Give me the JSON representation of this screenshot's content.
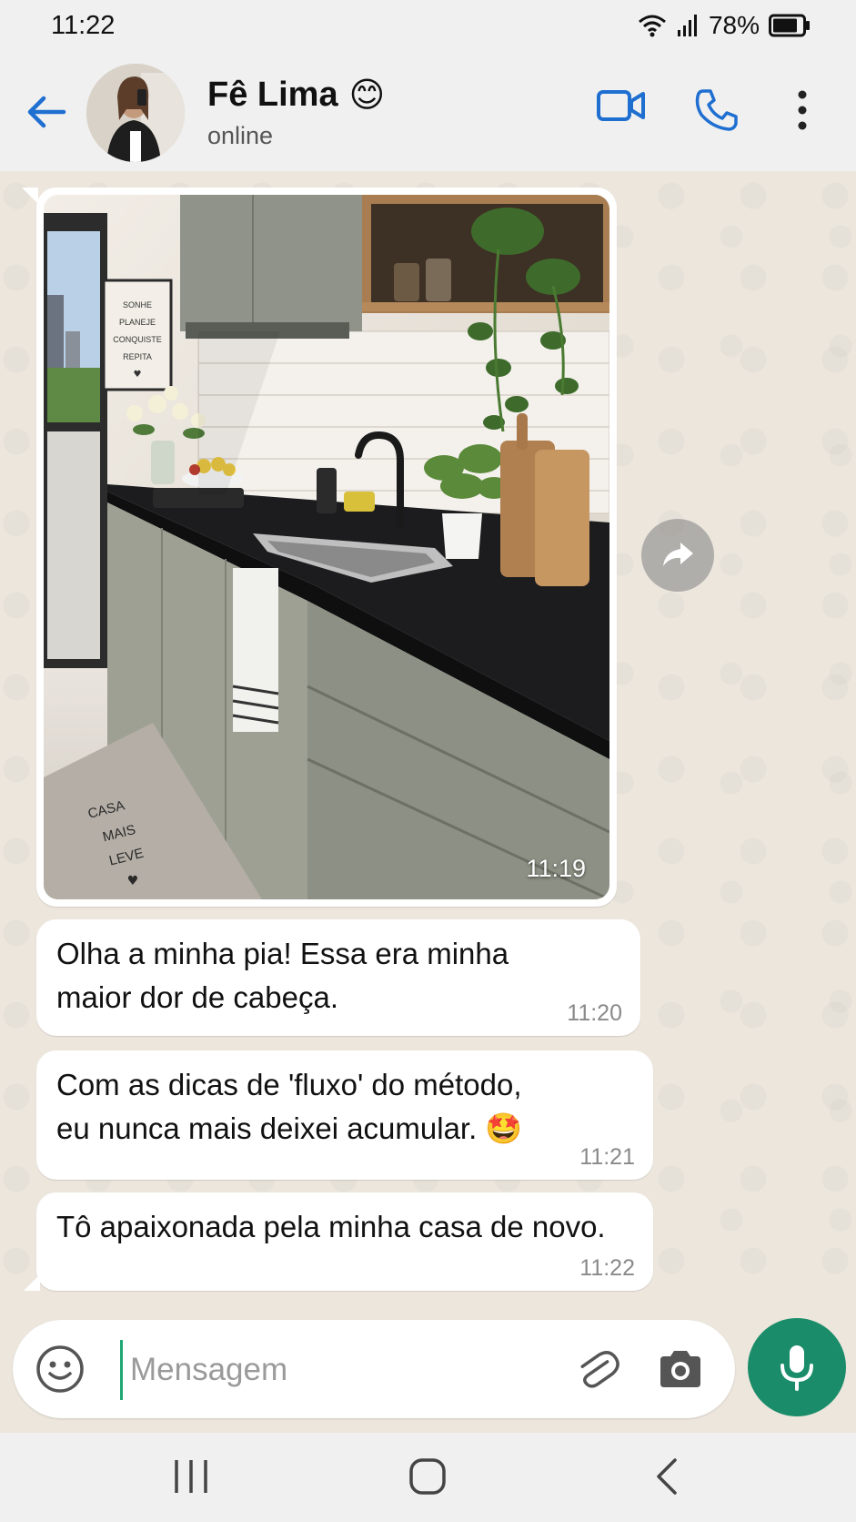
{
  "status_bar": {
    "time": "11:22",
    "battery": "78%",
    "icons": [
      "wifi-icon",
      "signal-icon",
      "battery-icon"
    ]
  },
  "header": {
    "contact_name": "Fê Lima",
    "name_emoji": "😊",
    "status": "online",
    "icons": [
      "back-arrow-icon",
      "video-call-icon",
      "phone-icon",
      "more-vert-icon"
    ],
    "accent_color": "#1f6fd1"
  },
  "messages": [
    {
      "type": "image",
      "time": "11:19",
      "photo_text": {
        "poster": [
          "SONHE",
          "PLANEJE",
          "CONQUISTE",
          "REPITA",
          "♥"
        ],
        "rug": [
          "CASA",
          "MAIS",
          "LEVE",
          "♥"
        ]
      }
    },
    {
      "type": "text",
      "lines": [
        "Olha a minha pia! Essa era minha",
        "maior dor de cabeça."
      ],
      "time": "11:20"
    },
    {
      "type": "text",
      "lines": [
        "Com as dicas de 'fluxo' do método,",
        "eu nunca mais deixei acumular. 🤩"
      ],
      "time": "11:21"
    },
    {
      "type": "text",
      "lines": [
        "Tô apaixonada pela minha casa de novo."
      ],
      "time": "11:22"
    }
  ],
  "input": {
    "placeholder": "Mensagem",
    "value": "",
    "icons": [
      "emoji-icon",
      "attach-icon",
      "camera-icon",
      "mic-icon"
    ],
    "mic_color": "#1a8c69"
  },
  "nav_bar": {
    "icons": [
      "recents-icon",
      "home-icon",
      "back-icon"
    ]
  }
}
